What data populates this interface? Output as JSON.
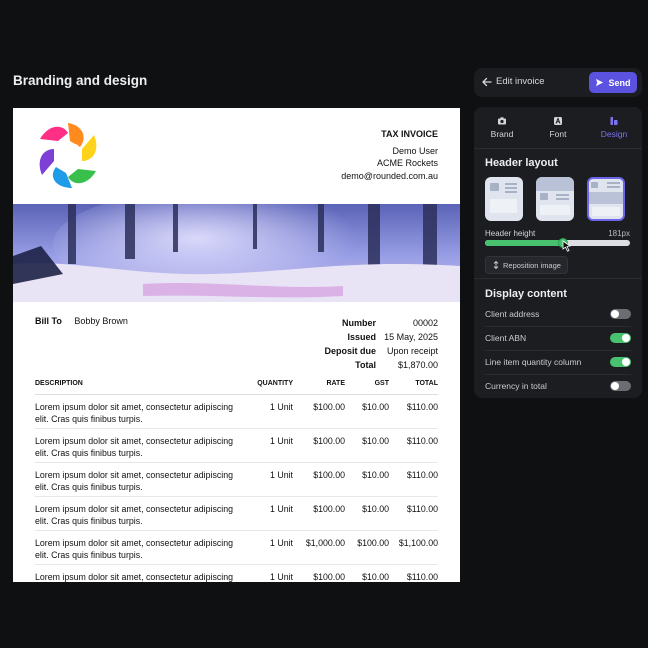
{
  "page": {
    "title": "Branding and design"
  },
  "topbar": {
    "edit_label": "Edit invoice",
    "send_label": "Send"
  },
  "invoice": {
    "doc_title": "TAX INVOICE",
    "sender_name": "Demo User",
    "sender_company": "ACME Rockets",
    "sender_email": "demo@rounded.com.au",
    "bill_to_label": "Bill To",
    "bill_to_name": "Bobby Brown",
    "meta": [
      {
        "label": "Number",
        "value": "00002"
      },
      {
        "label": "Issued",
        "value": "15 May, 2025"
      },
      {
        "label": "Deposit due",
        "value": "Upon receipt"
      },
      {
        "label": "Total",
        "value": "$1,870.00"
      }
    ],
    "columns": {
      "description": "DESCRIPTION",
      "quantity": "QUANTITY",
      "rate": "RATE",
      "gst": "GST",
      "total": "TOTAL"
    },
    "items": [
      {
        "desc": "Lorem ipsum dolor sit amet, consectetur adipiscing elit. Cras quis finibus turpis.",
        "qty": "1 Unit",
        "rate": "$100.00",
        "gst": "$10.00",
        "total": "$110.00"
      },
      {
        "desc": "Lorem ipsum dolor sit amet, consectetur adipiscing elit. Cras quis finibus turpis.",
        "qty": "1 Unit",
        "rate": "$100.00",
        "gst": "$10.00",
        "total": "$110.00"
      },
      {
        "desc": "Lorem ipsum dolor sit amet, consectetur adipiscing elit. Cras quis finibus turpis.",
        "qty": "1 Unit",
        "rate": "$100.00",
        "gst": "$10.00",
        "total": "$110.00"
      },
      {
        "desc": "Lorem ipsum dolor sit amet, consectetur adipiscing elit. Cras quis finibus turpis.",
        "qty": "1 Unit",
        "rate": "$100.00",
        "gst": "$10.00",
        "total": "$110.00"
      },
      {
        "desc": "Lorem ipsum dolor sit amet, consectetur adipiscing elit. Cras quis finibus turpis.",
        "qty": "1 Unit",
        "rate": "$1,000.00",
        "gst": "$100.00",
        "total": "$1,100.00"
      },
      {
        "desc": "Lorem ipsum dolor sit amet, consectetur adipiscing elit. Cras quis finibus turpis.",
        "qty": "1 Unit",
        "rate": "$100.00",
        "gst": "$10.00",
        "total": "$110.00"
      }
    ]
  },
  "panel": {
    "tabs": [
      {
        "label": "Brand",
        "icon": "camera-icon"
      },
      {
        "label": "Font",
        "icon": "font-icon"
      },
      {
        "label": "Design",
        "icon": "design-icon",
        "active": true
      }
    ],
    "header_layout_title": "Header layout",
    "layouts": [
      "layout-left",
      "layout-banner",
      "layout-full-banner"
    ],
    "selected_layout": "layout-full-banner",
    "header_height_label": "Header height",
    "header_height_value": "181px",
    "header_height_fraction": 0.53,
    "reposition_label": "Reposition image",
    "display_content_title": "Display content",
    "toggles": [
      {
        "label": "Client address",
        "on": false
      },
      {
        "label": "Client ABN",
        "on": true
      },
      {
        "label": "Line item quantity column",
        "on": true
      },
      {
        "label": "Currency in total",
        "on": false
      }
    ]
  },
  "colors": {
    "accent": "#5b53e0",
    "toggle_on": "#48c26e",
    "background": "#0f1012"
  }
}
